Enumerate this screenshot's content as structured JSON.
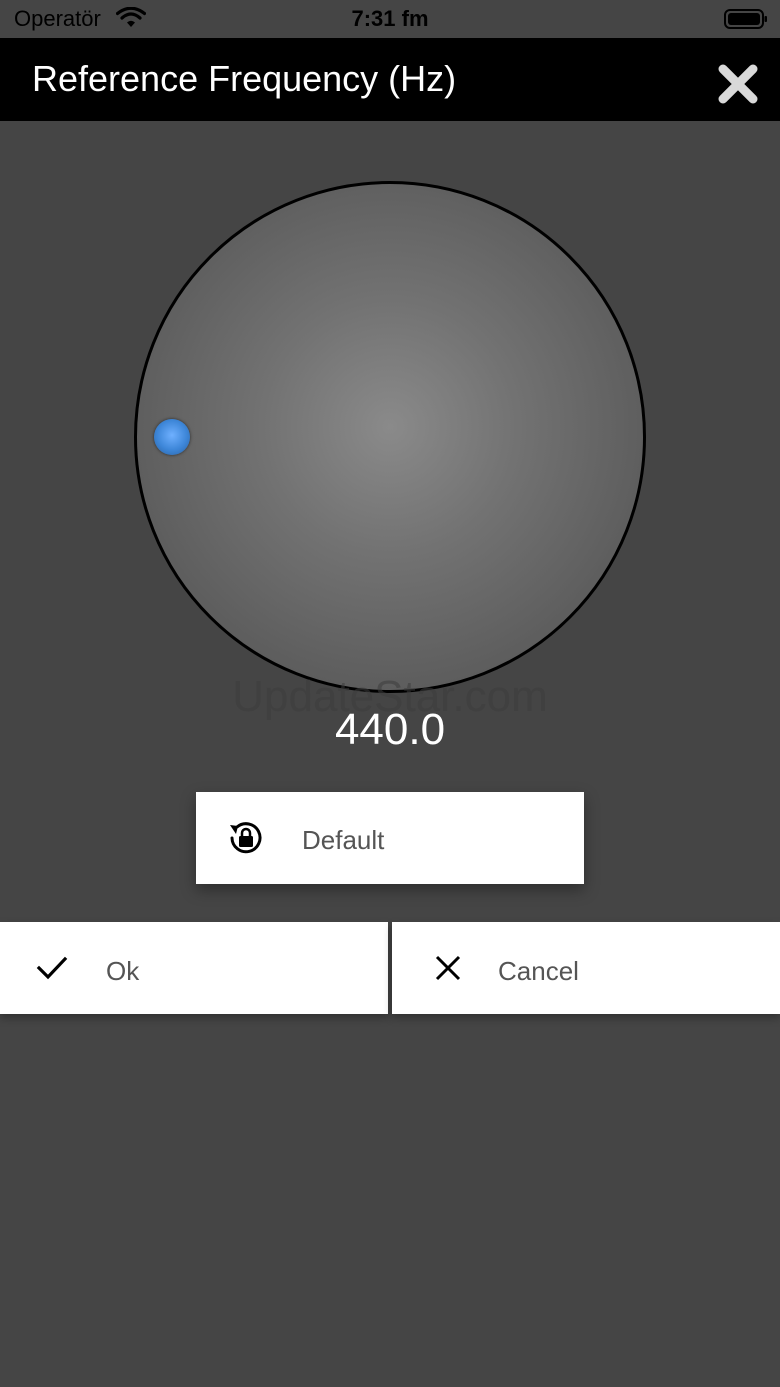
{
  "status_bar": {
    "carrier": "Operatör",
    "time": "7:31 fm"
  },
  "header": {
    "title": "Reference Frequency (Hz)",
    "close_icon": "close-icon"
  },
  "knob": {
    "value": "440.0",
    "accent_color": "#3d86d8"
  },
  "watermark": "UpdateStar.com",
  "buttons": {
    "default_label": "Default",
    "default_icon": "lock-rotate-icon",
    "ok_label": "Ok",
    "ok_icon": "check-icon",
    "cancel_label": "Cancel",
    "cancel_icon": "x-icon"
  }
}
